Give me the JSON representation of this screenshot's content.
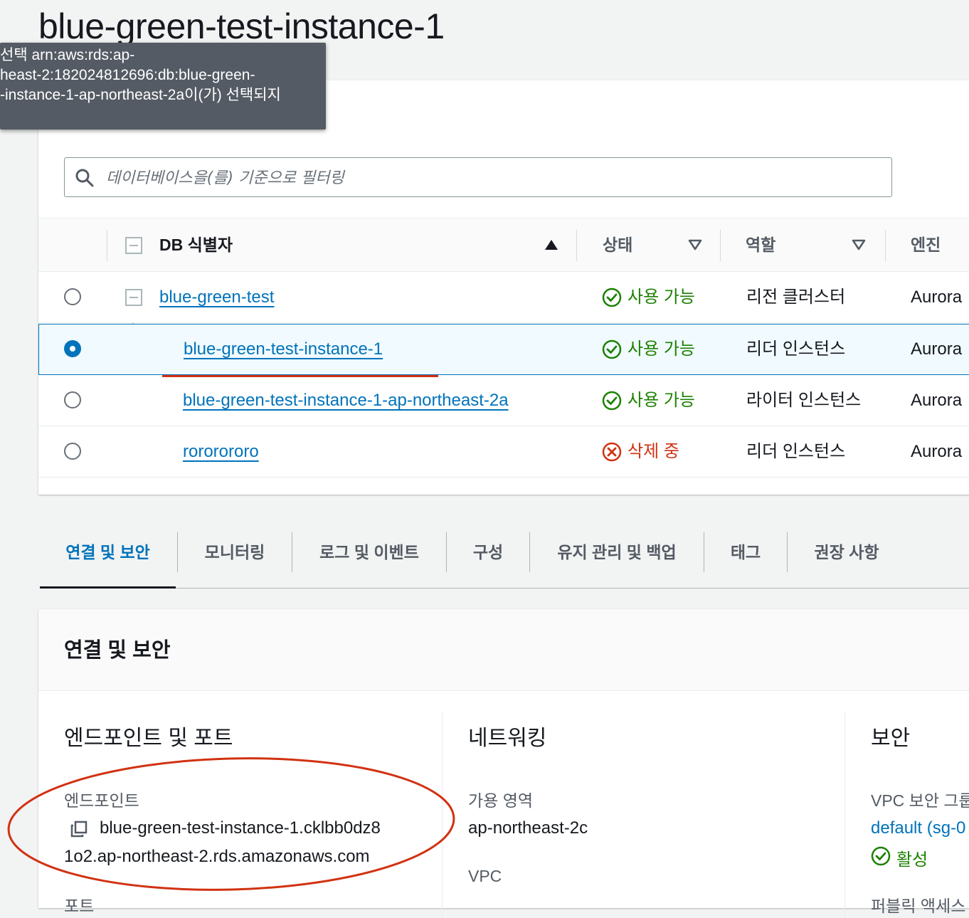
{
  "page": {
    "title": "blue-green-test-instance-1"
  },
  "tooltip": {
    "lines": [
      "선택 arn:aws:rds:ap-",
      "heast-2:182024812696:db:blue-green-",
      "-instance-1-ap-northeast-2a이(가) 선택되지"
    ]
  },
  "filter": {
    "placeholder": "데이터베이스을(를) 기준으로 필터링"
  },
  "table": {
    "columns": {
      "id": "DB 식별자",
      "status": "상태",
      "role": "역할",
      "engine": "엔진"
    },
    "rows": [
      {
        "id": "blue-green-test",
        "status": "사용 가능",
        "role": "리전 클러스터",
        "engine": "Aurora",
        "selected": false
      },
      {
        "id": "blue-green-test-instance-1",
        "status": "사용 가능",
        "role": "리더 인스턴스",
        "engine": "Aurora",
        "selected": true
      },
      {
        "id": "blue-green-test-instance-1-ap-northeast-2a",
        "status": "사용 가능",
        "role": "라이터 인스턴스",
        "engine": "Aurora",
        "selected": false
      },
      {
        "id": "rororororo",
        "status": "삭제 중",
        "role": "리더 인스턴스",
        "engine": "Aurora",
        "selected": false
      }
    ]
  },
  "tabs": [
    "연결 및 보안",
    "모니터링",
    "로그 및 이벤트",
    "구성",
    "유지 관리 및 백업",
    "태그",
    "권장 사항"
  ],
  "details": {
    "title": "연결 및 보안",
    "endpoint_section": {
      "title": "엔드포인트 및 포트",
      "endpoint_label": "엔드포인트",
      "endpoint_line1": "blue-green-test-instance-1.cklbb0dz8",
      "endpoint_line2": "1o2.ap-northeast-2.rds.amazonaws.com",
      "port_label": "포트"
    },
    "network_section": {
      "title": "네트워킹",
      "az_label": "가용 영역",
      "az_value": "ap-northeast-2c",
      "vpc_label": "VPC"
    },
    "security_section": {
      "title": "보안",
      "sg_label": "VPC 보안 그룹",
      "sg_value": "default (sg-0",
      "sg_status": "활성",
      "next_label": "퍼블릭 액세스"
    }
  },
  "colors": {
    "link": "#0073bb",
    "success": "#1d8102",
    "error": "#d13212",
    "annotation": "#d13212"
  }
}
